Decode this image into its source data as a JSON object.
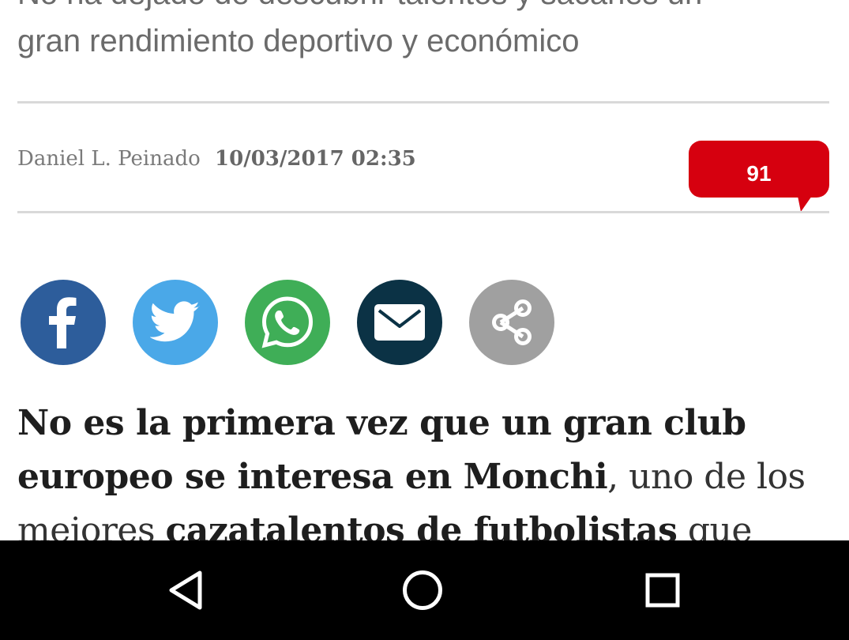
{
  "article": {
    "subtitle_line1": "No ha dejado de descubrir talentos y sacarles un",
    "subtitle_line2": "gran rendimiento deportivo y económico",
    "byline": {
      "author": "Daniel L. Peinado",
      "date": "10/03/2017 02:35"
    },
    "comments": {
      "count": "91",
      "color": "#d6000f"
    },
    "share_buttons": [
      {
        "icon": "facebook-icon",
        "color": "#2d5d9b"
      },
      {
        "icon": "twitter-icon",
        "color": "#4aa8e8"
      },
      {
        "icon": "whatsapp-icon",
        "color": "#3fae57"
      },
      {
        "icon": "email-icon",
        "color": "#0b3245"
      },
      {
        "icon": "share-icon",
        "color": "#a0a0a0"
      }
    ],
    "lead": {
      "bold1": "No es la primera vez que un gran club europeo se interesa en Monchi",
      "text1": ", uno de los mejores ",
      "bold2": "cazatalentos de futbolistas",
      "text2": " que existe en el"
    }
  },
  "navbar": {
    "back_icon": "back-triangle-icon",
    "home_icon": "home-circle-icon",
    "recents_icon": "recents-square-icon"
  }
}
